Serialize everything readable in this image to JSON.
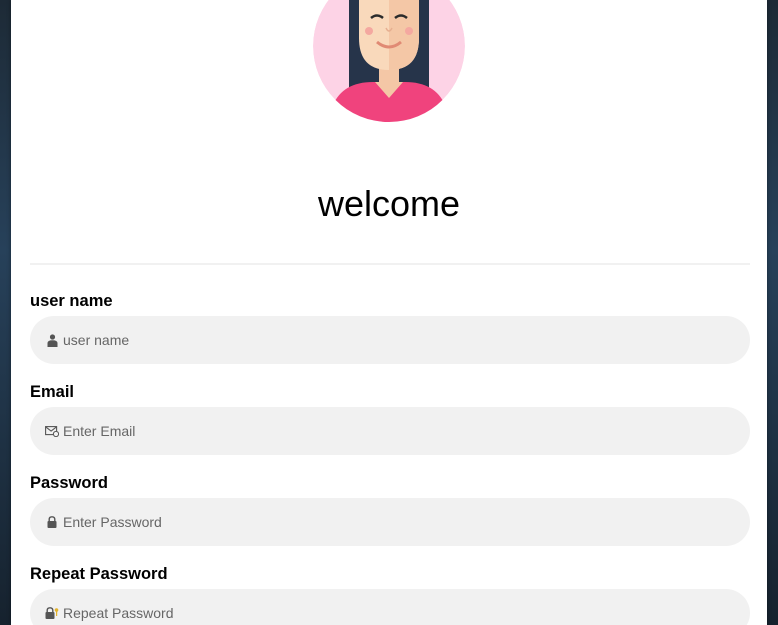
{
  "header": {
    "title": "welcome"
  },
  "form": {
    "fields": [
      {
        "label": "user name",
        "placeholder": "user name",
        "icon": "user-icon"
      },
      {
        "label": "Email",
        "placeholder": "Enter Email",
        "icon": "envelope-icon"
      },
      {
        "label": "Password",
        "placeholder": "Enter Password",
        "icon": "lock-icon"
      },
      {
        "label": "Repeat Password",
        "placeholder": "Repeat Password",
        "icon": "lock-key-icon"
      }
    ]
  },
  "colors": {
    "card": "#ffffff",
    "input_bg": "#f1f1f1",
    "avatar_bg": "#fdd3e6",
    "shirt": "#f0437d",
    "hair": "#26344a"
  }
}
